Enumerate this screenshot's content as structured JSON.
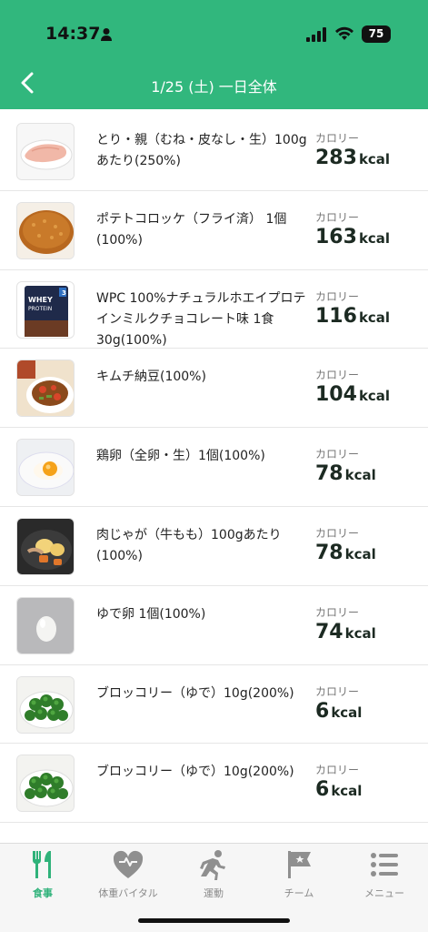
{
  "status_bar": {
    "time": "14:37",
    "battery": "75"
  },
  "nav": {
    "title": "1/25 (土) 一日全体"
  },
  "items": [
    {
      "name": "とり・親（むね・皮なし・生）100gあたり(250%)",
      "cal_label": "カロリー",
      "cal": "283",
      "unit": "kcal",
      "thumb": "chicken-breast"
    },
    {
      "name": "ポテトコロッケ（フライ済） 1個(100%)",
      "cal_label": "カロリー",
      "cal": "163",
      "unit": "kcal",
      "thumb": "croquette"
    },
    {
      "name": "WPC 100%ナチュラルホエイプロテインミルクチョコレート味 1食30g(100%)",
      "cal_label": "カロリー",
      "cal": "116",
      "unit": "kcal",
      "thumb": "protein-bag",
      "thumb_text": "WHEY PROTEIN"
    },
    {
      "name": "キムチ納豆(100%)",
      "cal_label": "カロリー",
      "cal": "104",
      "unit": "kcal",
      "thumb": "kimchi-natto"
    },
    {
      "name": "鶏卵（全卵・生）1個(100%)",
      "cal_label": "カロリー",
      "cal": "78",
      "unit": "kcal",
      "thumb": "raw-egg"
    },
    {
      "name": "肉じゃが（牛もも）100gあたり(100%)",
      "cal_label": "カロリー",
      "cal": "78",
      "unit": "kcal",
      "thumb": "nikujaga"
    },
    {
      "name": "ゆで卵 1個(100%)",
      "cal_label": "カロリー",
      "cal": "74",
      "unit": "kcal",
      "thumb": "boiled-egg"
    },
    {
      "name": "ブロッコリー（ゆで）10g(200%)",
      "cal_label": "カロリー",
      "cal": "6",
      "unit": "kcal",
      "thumb": "broccoli"
    },
    {
      "name": "ブロッコリー（ゆで）10g(200%)",
      "cal_label": "カロリー",
      "cal": "6",
      "unit": "kcal",
      "thumb": "broccoli"
    }
  ],
  "tabs": [
    {
      "label": "食事",
      "icon": "fork-knife-icon",
      "active": true
    },
    {
      "label": "体重バイタル",
      "icon": "heart-pulse-icon",
      "active": false
    },
    {
      "label": "運動",
      "icon": "runner-icon",
      "active": false
    },
    {
      "label": "チーム",
      "icon": "flag-icon",
      "active": false
    },
    {
      "label": "メニュー",
      "icon": "menu-icon",
      "active": false
    }
  ],
  "colors": {
    "accent": "#31b77d",
    "text": "#1c2a22"
  }
}
